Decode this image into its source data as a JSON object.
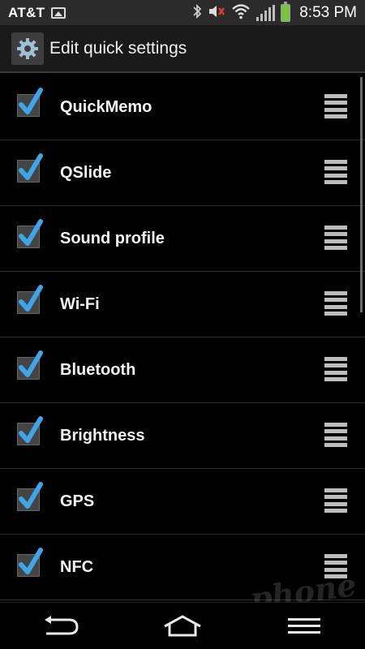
{
  "status_bar": {
    "carrier": "AT&T",
    "time": "8:53 PM",
    "icons": [
      "image-icon",
      "bluetooth-icon",
      "mute-icon",
      "wifi-icon",
      "signal-icon",
      "battery-icon"
    ],
    "battery_color": "#78c23d"
  },
  "header": {
    "title": "Edit quick settings",
    "icon": "gear-icon"
  },
  "settings": [
    {
      "label": "QuickMemo",
      "checked": true
    },
    {
      "label": "QSlide",
      "checked": true
    },
    {
      "label": "Sound profile",
      "checked": true
    },
    {
      "label": "Wi-Fi",
      "checked": true
    },
    {
      "label": "Bluetooth",
      "checked": true
    },
    {
      "label": "Brightness",
      "checked": true
    },
    {
      "label": "GPS",
      "checked": true
    },
    {
      "label": "NFC",
      "checked": true
    }
  ],
  "nav": {
    "back": "back-icon",
    "home": "home-icon",
    "menu": "menu-icon"
  },
  "watermark": "phone scoop",
  "accent_color": "#3ea6e8"
}
